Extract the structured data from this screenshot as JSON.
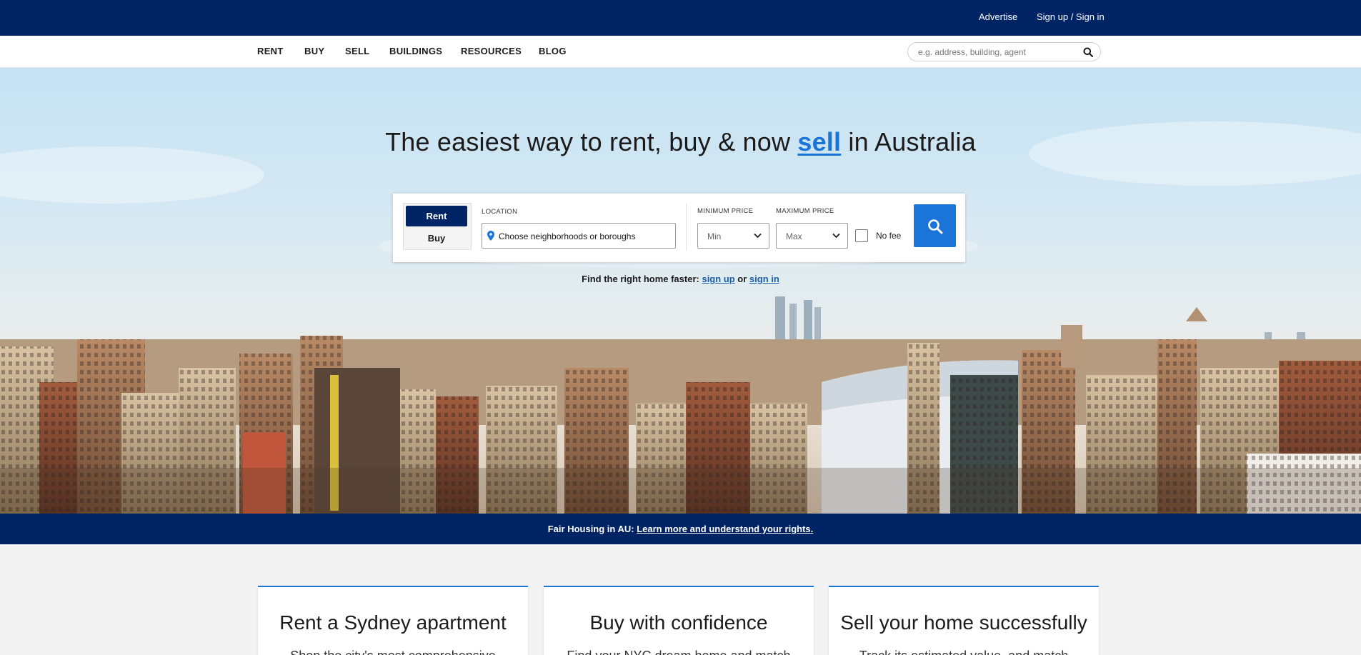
{
  "topbar": {
    "advertise": "Advertise",
    "signup": "Sign up / Sign in"
  },
  "nav": {
    "items": [
      "RENT",
      "BUY",
      "SELL",
      "BUILDINGS",
      "RESOURCES",
      "BLOG"
    ],
    "search_placeholder": "e.g. address, building, agent"
  },
  "hero": {
    "headline_pre": "The easiest way to rent, buy & now ",
    "headline_link": "sell",
    "headline_post": " in Australia"
  },
  "search_panel": {
    "toggle": {
      "rent": "Rent",
      "buy": "Buy",
      "selected": "Rent"
    },
    "location_label": "LOCATION",
    "location_value": "Choose neighborhoods or boroughs",
    "min_price_label": "MINIMUM PRICE",
    "min_price_value": "Min",
    "max_price_label": "MAXIMUM PRICE",
    "max_price_value": "Max",
    "no_fee_label": "No fee",
    "no_fee_checked": false
  },
  "subline": {
    "text": "Find the right home faster: ",
    "signup": "sign up",
    "or": " or ",
    "signin": "sign in"
  },
  "banner": {
    "text": "Fair Housing in AU: ",
    "link": "Learn more and understand your rights."
  },
  "cards": [
    {
      "title": "Rent a Sydney apartment",
      "body": "Shop the city's most comprehensive"
    },
    {
      "title": "Buy with confidence",
      "body": "Find your NYC dream home and match"
    },
    {
      "title": "Sell your home successfully",
      "body": "Track its estimated value, and match"
    }
  ],
  "colors": {
    "navy": "#002464",
    "accent_blue": "#1b74d7",
    "page_bg": "#f3f3f3"
  }
}
